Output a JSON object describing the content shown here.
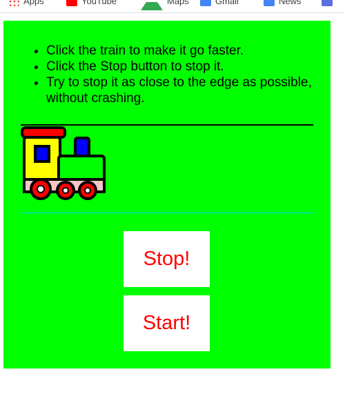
{
  "bookmarks": [
    {
      "icon": "apps-icon",
      "label": "Apps"
    },
    {
      "icon": "youtube-icon",
      "label": "YouTube"
    },
    {
      "icon": "maps-icon",
      "label": "Maps"
    },
    {
      "icon": "gmail-icon",
      "label": "Gmail"
    },
    {
      "icon": "news-icon",
      "label": "News"
    }
  ],
  "instructions": [
    "Click the train to make it go faster.",
    "Click the Stop button to stop it.",
    "Try to stop it as close to the edge as possible, without crashing."
  ],
  "buttons": {
    "stop_label": "Stop!",
    "start_label": "Start!"
  },
  "colors": {
    "background": "#00ff00",
    "button_text": "#ff0000",
    "track_top": "#000000",
    "track_bottom": "#00cfff"
  }
}
